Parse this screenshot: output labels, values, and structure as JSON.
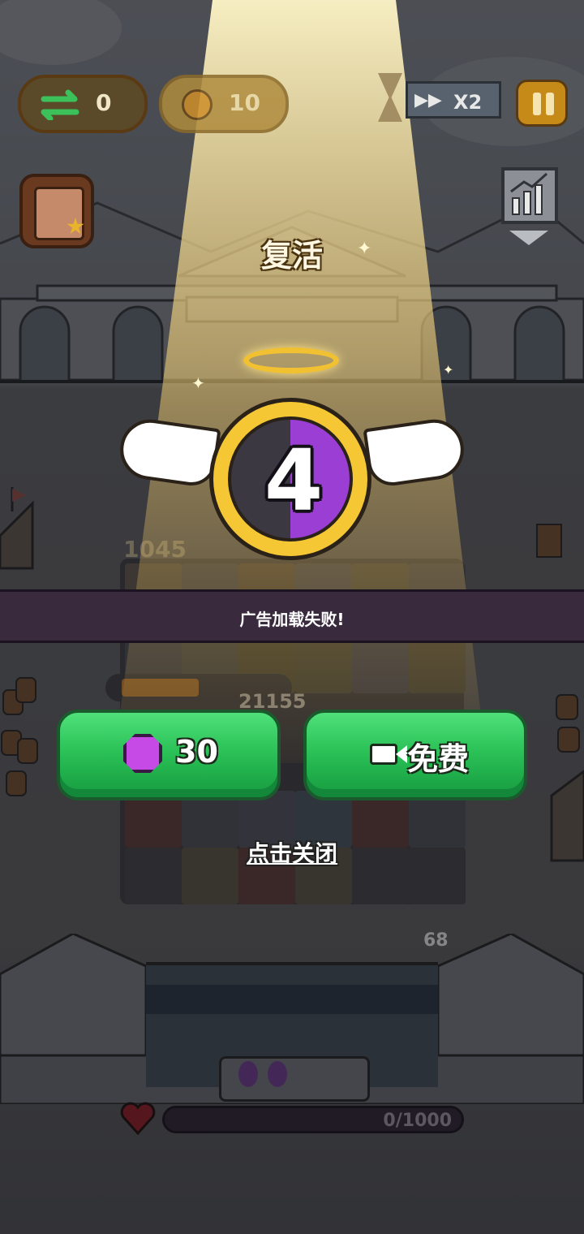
{
  "hud": {
    "swap_count": "0",
    "boost_count": "10",
    "speed_label": "X2"
  },
  "revive": {
    "title": "复活",
    "countdown": "4",
    "ad_error": "广告加载失败!",
    "gem_cost": "30",
    "free_label": "免费",
    "close_hint": "点击关闭"
  },
  "board": {
    "score_left": "1045",
    "score_mid": "21155",
    "wave_counter": "68"
  },
  "base": {
    "hp": "0/1000"
  },
  "colors": {
    "button_green": "#2cc258",
    "counter_purple": "#9a3ed4",
    "halo_gold": "#f1c132"
  }
}
